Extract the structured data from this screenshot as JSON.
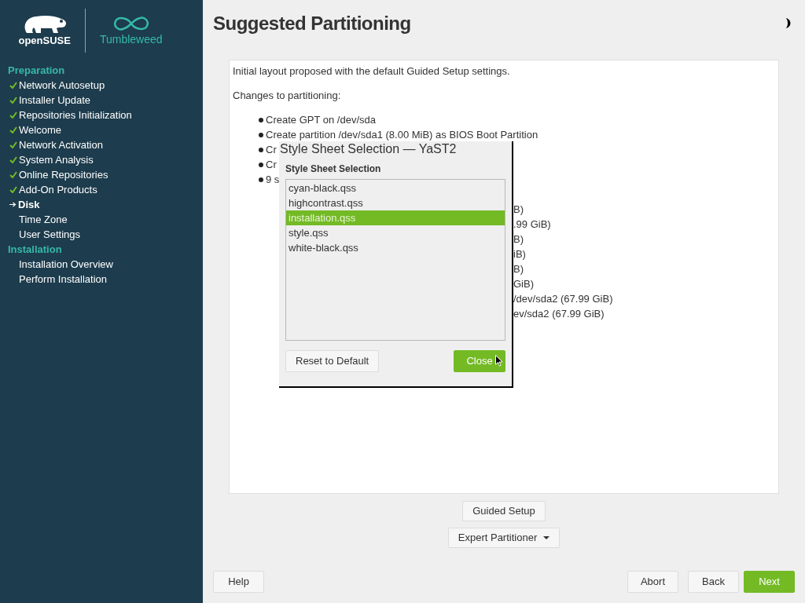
{
  "sidebar": {
    "logo": {
      "brand": "openSUSE",
      "product": "Tumbleweed"
    },
    "groups": [
      {
        "heading": "Preparation",
        "items": [
          {
            "label": "Network Autosetup",
            "done": true,
            "current": false
          },
          {
            "label": "Installer Update",
            "done": true,
            "current": false
          },
          {
            "label": "Repositories Initialization",
            "done": true,
            "current": false
          },
          {
            "label": "Welcome",
            "done": true,
            "current": false
          },
          {
            "label": "Network Activation",
            "done": true,
            "current": false
          },
          {
            "label": "System Analysis",
            "done": true,
            "current": false
          },
          {
            "label": "Online Repositories",
            "done": true,
            "current": false
          },
          {
            "label": "Add-On Products",
            "done": true,
            "current": false
          },
          {
            "label": "Disk",
            "done": false,
            "current": true
          },
          {
            "label": "Time Zone",
            "done": false,
            "current": false
          },
          {
            "label": "User Settings",
            "done": false,
            "current": false
          }
        ]
      },
      {
        "heading": "Installation",
        "items": [
          {
            "label": "Installation Overview",
            "done": false,
            "current": false
          },
          {
            "label": "Perform Installation",
            "done": false,
            "current": false
          }
        ]
      }
    ]
  },
  "page": {
    "title": "Suggested Partitioning",
    "summary": "Initial layout proposed with the default Guided Setup settings.",
    "changes_heading": "Changes to partitioning:",
    "changes": [
      "Create GPT on /dev/sda",
      "Create partition /dev/sda1 (8.00 MiB) as BIOS Boot Partition",
      "Cr",
      "Cr",
      "9 s"
    ],
    "covered_lines": [
      "B)",
      ".99 GiB)",
      "B)",
      "iB)",
      "B)",
      "GiB)",
      "/dev/sda2 (67.99 GiB)",
      "ev/sda2 (67.99 GiB)"
    ],
    "buttons": [
      "Guided Setup",
      "Expert Partitioner"
    ]
  },
  "footer": {
    "left": [
      "Help"
    ],
    "right": [
      {
        "label": "Abort",
        "primary": false
      },
      {
        "label": "Back",
        "primary": false
      },
      {
        "label": "Next",
        "primary": true
      }
    ]
  },
  "dialog": {
    "title": "Style Sheet Selection — YaST2",
    "heading": "Style Sheet Selection",
    "options": [
      {
        "label": "cyan-black.qss",
        "selected": false
      },
      {
        "label": "highcontrast.qss",
        "selected": false
      },
      {
        "label": "installation.qss",
        "selected": true
      },
      {
        "label": "style.qss",
        "selected": false
      },
      {
        "label": "white-black.qss",
        "selected": false
      }
    ],
    "buttons": [
      {
        "label": "Reset to Default",
        "primary": false
      },
      {
        "label": "Close",
        "primary": true
      }
    ]
  }
}
